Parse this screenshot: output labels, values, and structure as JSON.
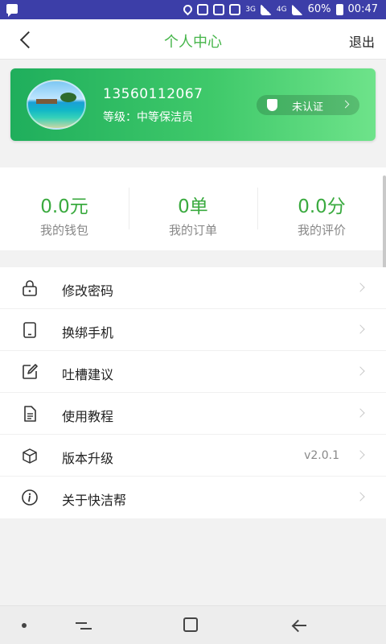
{
  "status_bar": {
    "battery": "60%",
    "time": "00:47",
    "network_3g": "3G",
    "network_4g": "4G"
  },
  "header": {
    "title": "个人中心",
    "logout_label": "退出"
  },
  "profile": {
    "phone": "13560112067",
    "level": "等级：中等保洁员",
    "verify_label": "未认证"
  },
  "stats": [
    {
      "value": "0.0元",
      "label": "我的钱包"
    },
    {
      "value": "0单",
      "label": "我的订单"
    },
    {
      "value": "0.0分",
      "label": "我的评价"
    }
  ],
  "menu": [
    {
      "label": "修改密码",
      "icon": "lock-icon"
    },
    {
      "label": "换绑手机",
      "icon": "tablet-icon"
    },
    {
      "label": "吐槽建议",
      "icon": "edit-icon"
    },
    {
      "label": "使用教程",
      "icon": "document-icon"
    },
    {
      "label": "版本升级",
      "icon": "package-icon",
      "value": "v2.0.1"
    },
    {
      "label": "关于快洁帮",
      "icon": "info-icon"
    }
  ],
  "colors": {
    "status_bar": "#3c3ea8",
    "accent_green": "#46b54a",
    "card_gradient_start": "#1fae5c",
    "card_gradient_end": "#6ee38a"
  }
}
